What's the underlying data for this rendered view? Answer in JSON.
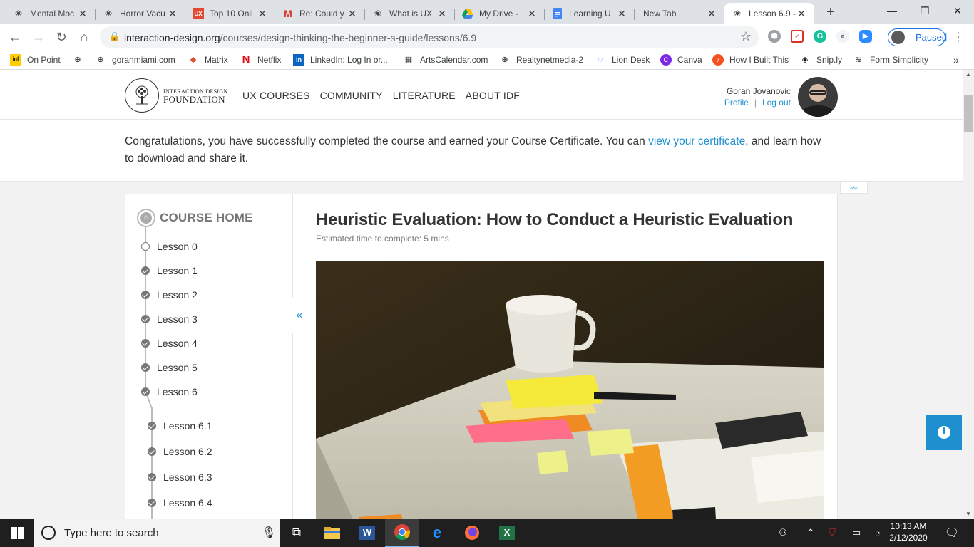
{
  "browser": {
    "tabs": [
      {
        "title": "Mental Moc",
        "icon": "idf-tree-icon"
      },
      {
        "title": "Horror Vacu",
        "icon": "idf-tree-icon"
      },
      {
        "title": "Top 10 Onli",
        "icon": "ux-logo-icon"
      },
      {
        "title": "Re: Could y",
        "icon": "gmail-icon"
      },
      {
        "title": "What is UX",
        "icon": "idf-tree-icon"
      },
      {
        "title": "My Drive -",
        "icon": "google-drive-icon"
      },
      {
        "title": "Learning U",
        "icon": "google-docs-icon"
      },
      {
        "title": "New Tab",
        "icon": ""
      },
      {
        "title": "Lesson 6.9 -",
        "icon": "idf-tree-icon"
      }
    ],
    "url_host": "interaction-design.org",
    "url_path": "/courses/design-thinking-the-beginner-s-guide/lessons/6.9",
    "profile_status": "Paused",
    "bookmarks": [
      {
        "label": "On Point"
      },
      {
        "label": "goranmiami.com"
      },
      {
        "label": "Matrix"
      },
      {
        "label": "Netflix"
      },
      {
        "label": "LinkedIn: Log In or..."
      },
      {
        "label": "ArtsCalendar.com"
      },
      {
        "label": "Realtynetmedia-2"
      },
      {
        "label": "Lion Desk"
      },
      {
        "label": "Canva"
      },
      {
        "label": "How I Built This"
      },
      {
        "label": "Snip.ly"
      },
      {
        "label": "Form Simplicity"
      }
    ]
  },
  "site": {
    "logo_line1": "INTERACTION DESIGN",
    "logo_line2": "FOUNDATION",
    "nav": [
      "UX COURSES",
      "COMMUNITY",
      "LITERATURE",
      "ABOUT IDF"
    ],
    "user_name": "Goran Jovanovic",
    "profile_link": "Profile",
    "logout_link": "Log out"
  },
  "congrats": {
    "before": "Congratulations, you have successfully completed the course and earned your Course Certificate. You can ",
    "link": "view your certificate",
    "after": ", and learn how to download and share it."
  },
  "sidebar": {
    "home_label": "COURSE HOME",
    "lessons": [
      {
        "label": "Lesson 0",
        "completed": false
      },
      {
        "label": "Lesson 1",
        "completed": true
      },
      {
        "label": "Lesson 2",
        "completed": true
      },
      {
        "label": "Lesson 3",
        "completed": true
      },
      {
        "label": "Lesson 4",
        "completed": true
      },
      {
        "label": "Lesson 5",
        "completed": true
      },
      {
        "label": "Lesson 6",
        "completed": true
      }
    ],
    "sublessons": [
      {
        "label": "Lesson 6.1",
        "completed": true
      },
      {
        "label": "Lesson 6.2",
        "completed": true
      },
      {
        "label": "Lesson 6.3",
        "completed": true
      },
      {
        "label": "Lesson 6.4",
        "completed": true
      }
    ]
  },
  "article": {
    "title": "Heuristic Evaluation: How to Conduct a Heuristic Evaluation",
    "estimate": "Estimated time to complete: 5 mins"
  },
  "taskbar": {
    "search_placeholder": "Type here to search",
    "time": "10:13 AM",
    "date": "2/12/2020"
  },
  "colors": {
    "link": "#1e90d0",
    "info_button": "#1e90d0",
    "completed_dot": "#777777"
  }
}
